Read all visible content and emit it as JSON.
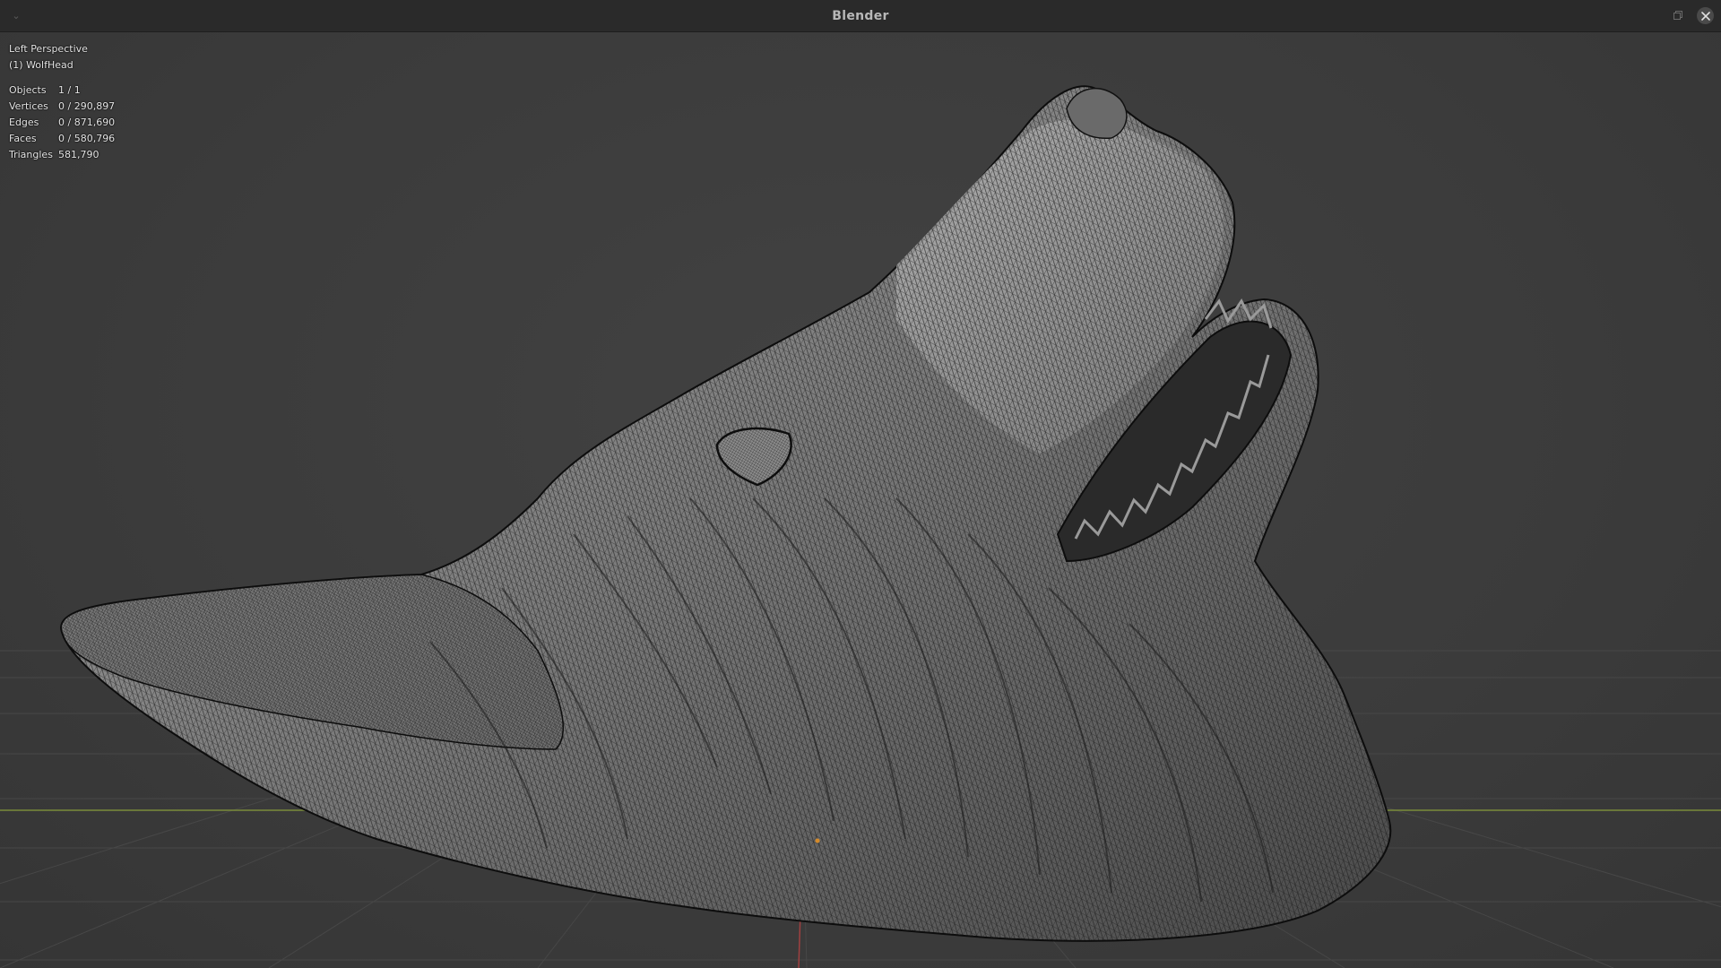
{
  "window": {
    "title": "Blender",
    "menu_icon": "chevron-down-icon",
    "restore_icon": "restore-window-icon",
    "close_icon": "close-icon"
  },
  "viewport": {
    "view_name": "Left Perspective",
    "object_name": "(1) WolfHead",
    "stats": [
      {
        "label": "Objects",
        "value": "1 / 1"
      },
      {
        "label": "Vertices",
        "value": "0 / 290,897"
      },
      {
        "label": "Edges",
        "value": "0 / 871,690"
      },
      {
        "label": "Faces",
        "value": "0 / 580,796"
      },
      {
        "label": "Triangles",
        "value": "581,790"
      }
    ],
    "mesh_icon": "wolf-head-wireframe-mesh",
    "colors": {
      "background": "#3d3d3d",
      "grid": "#4a4a4a",
      "x_axis": "#7a8c3a",
      "y_axis": "#a04040",
      "mesh_fill": "#8e8e8e",
      "wire": "#1a1a1a"
    }
  }
}
